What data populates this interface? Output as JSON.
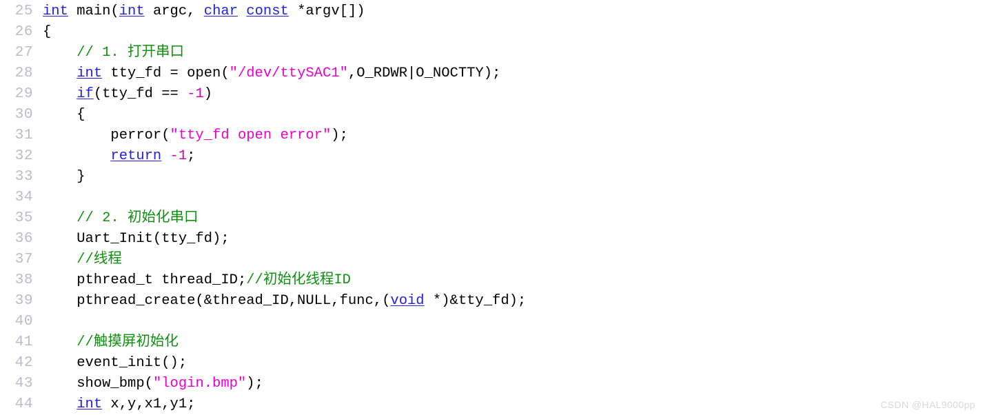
{
  "editor": {
    "language": "c",
    "background_color": "#ffffff",
    "line_number_color": "#bcbcc4",
    "first_line_number": 25,
    "colors": {
      "keyword": "#2222dd",
      "string": "#ee00cc",
      "number": "#d400b0",
      "comment": "#109010",
      "plain": "#000000"
    }
  },
  "watermark": {
    "text": "CSDN @HAL9000pp"
  },
  "lines": [
    {
      "number": "25",
      "tokens": [
        {
          "t": "int",
          "c": "kw"
        },
        {
          "t": " ",
          "c": "plain"
        },
        {
          "t": "main(",
          "c": "plain"
        },
        {
          "t": "int",
          "c": "kw"
        },
        {
          "t": " argc, ",
          "c": "plain"
        },
        {
          "t": "char",
          "c": "kw"
        },
        {
          "t": " ",
          "c": "plain"
        },
        {
          "t": "const",
          "c": "kw"
        },
        {
          "t": " *argv[])",
          "c": "plain"
        }
      ]
    },
    {
      "number": "26",
      "tokens": [
        {
          "t": "{",
          "c": "plain"
        }
      ]
    },
    {
      "number": "27",
      "tokens": [
        {
          "t": "    ",
          "c": "plain"
        },
        {
          "t": "// 1. 打开串口",
          "c": "comment"
        }
      ]
    },
    {
      "number": "28",
      "tokens": [
        {
          "t": "    ",
          "c": "plain"
        },
        {
          "t": "int",
          "c": "kw"
        },
        {
          "t": " tty_fd = open(",
          "c": "plain"
        },
        {
          "t": "\"/dev/ttySAC1\"",
          "c": "str"
        },
        {
          "t": ",O_RDWR|O_NOCTTY);",
          "c": "plain"
        }
      ]
    },
    {
      "number": "29",
      "tokens": [
        {
          "t": "    ",
          "c": "plain"
        },
        {
          "t": "if",
          "c": "kw"
        },
        {
          "t": "(tty_fd == ",
          "c": "plain"
        },
        {
          "t": "-1",
          "c": "num"
        },
        {
          "t": ")",
          "c": "plain"
        }
      ]
    },
    {
      "number": "30",
      "tokens": [
        {
          "t": "    {",
          "c": "plain"
        }
      ]
    },
    {
      "number": "31",
      "tokens": [
        {
          "t": "        perror(",
          "c": "plain"
        },
        {
          "t": "\"tty_fd open error\"",
          "c": "str"
        },
        {
          "t": ");",
          "c": "plain"
        }
      ]
    },
    {
      "number": "32",
      "tokens": [
        {
          "t": "        ",
          "c": "plain"
        },
        {
          "t": "return",
          "c": "kw"
        },
        {
          "t": " ",
          "c": "plain"
        },
        {
          "t": "-1",
          "c": "num"
        },
        {
          "t": ";",
          "c": "plain"
        }
      ]
    },
    {
      "number": "33",
      "tokens": [
        {
          "t": "    }",
          "c": "plain"
        }
      ]
    },
    {
      "number": "34",
      "tokens": [
        {
          "t": "",
          "c": "plain"
        }
      ]
    },
    {
      "number": "35",
      "tokens": [
        {
          "t": "    ",
          "c": "plain"
        },
        {
          "t": "// 2. 初始化串口",
          "c": "comment"
        }
      ]
    },
    {
      "number": "36",
      "tokens": [
        {
          "t": "    Uart_Init(tty_fd);",
          "c": "plain"
        }
      ]
    },
    {
      "number": "37",
      "tokens": [
        {
          "t": "    ",
          "c": "plain"
        },
        {
          "t": "//线程",
          "c": "comment"
        }
      ]
    },
    {
      "number": "38",
      "tokens": [
        {
          "t": "    pthread_t thread_ID;",
          "c": "plain"
        },
        {
          "t": "//初始化线程ID",
          "c": "comment"
        }
      ]
    },
    {
      "number": "39",
      "tokens": [
        {
          "t": "    pthread_create(&thread_ID,NULL,func,(",
          "c": "plain"
        },
        {
          "t": "void",
          "c": "kw"
        },
        {
          "t": " *)&tty_fd);",
          "c": "plain"
        }
      ]
    },
    {
      "number": "40",
      "tokens": [
        {
          "t": "",
          "c": "plain"
        }
      ]
    },
    {
      "number": "41",
      "tokens": [
        {
          "t": "    ",
          "c": "plain"
        },
        {
          "t": "//触摸屏初始化",
          "c": "comment"
        }
      ]
    },
    {
      "number": "42",
      "tokens": [
        {
          "t": "    event_init();",
          "c": "plain"
        }
      ]
    },
    {
      "number": "43",
      "tokens": [
        {
          "t": "    show_bmp(",
          "c": "plain"
        },
        {
          "t": "\"login.bmp\"",
          "c": "str"
        },
        {
          "t": ");",
          "c": "plain"
        }
      ]
    },
    {
      "number": "44",
      "tokens": [
        {
          "t": "    ",
          "c": "plain"
        },
        {
          "t": "int",
          "c": "kw"
        },
        {
          "t": " x,y,x1,y1;",
          "c": "plain"
        }
      ]
    }
  ]
}
